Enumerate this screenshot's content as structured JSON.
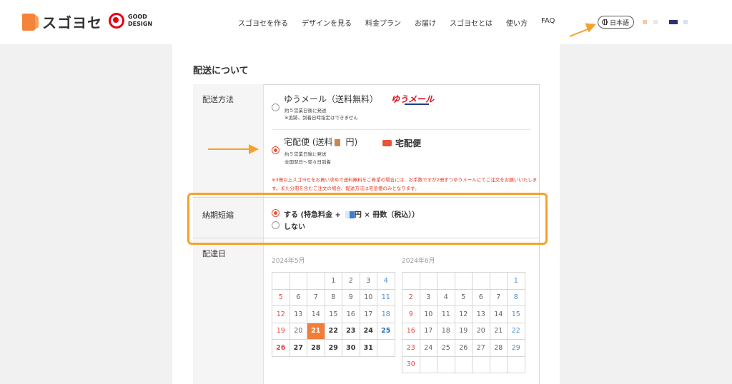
{
  "header": {
    "logo_text": "スゴヨセ",
    "gd_line1": "GOOD",
    "gd_line2": "DESIGN",
    "nav": [
      "スゴヨセを作る",
      "デザインを見る",
      "料金プラン",
      "お届け",
      "スゴヨセとは",
      "使い方",
      "FAQ"
    ],
    "language": "日本語",
    "swatches": [
      "#f9c9a8",
      "#e8e8ec",
      "#2d3270",
      "#d9dff7"
    ]
  },
  "section": {
    "title": "配送について",
    "shipping_label": "配送方法",
    "option_mail": {
      "title": "ゆうメール（送料無料）",
      "note1": "約５営業日後に発送",
      "note2": "※追跡、到着日時指定はできません",
      "logo": "ゆうメール"
    },
    "option_takkyubin": {
      "title_a": "宅配便 (送料",
      "title_b": "円)",
      "note1": "約５営業日後に発送",
      "note2": "全国翌日〜翌々日到着",
      "logo": "宅配便"
    },
    "notice": "※3冊以上スゴヨセをお買い求めで送料無料をご希望の場合には、お手数ですが2冊ずつゆうメールにてご注文をお願いいたします。また分冊を含むご注文の場合、配送方法は宅急便のみとなります。",
    "rush_label": "納期短縮",
    "rush_yes_a": "する (特急料金 +",
    "rush_yes_b": "円 × 冊数（税込））",
    "rush_no": "しない",
    "date_label": "配達日"
  },
  "calendar_may": {
    "title": "2024年5月",
    "rows": [
      [
        "",
        "",
        "",
        "1",
        "2",
        "3",
        "4"
      ],
      [
        "5",
        "6",
        "7",
        "8",
        "9",
        "10",
        "11"
      ],
      [
        "12",
        "13",
        "14",
        "15",
        "16",
        "17",
        "18"
      ],
      [
        "19",
        "20",
        "21",
        "22",
        "23",
        "24",
        "25"
      ],
      [
        "26",
        "27",
        "28",
        "29",
        "30",
        "31",
        ""
      ]
    ],
    "selected": "21"
  },
  "calendar_june": {
    "title": "2024年6月",
    "rows": [
      [
        "",
        "",
        "",
        "",
        "",
        "",
        "1"
      ],
      [
        "2",
        "3",
        "4",
        "5",
        "6",
        "7",
        "8"
      ],
      [
        "9",
        "10",
        "11",
        "12",
        "13",
        "14",
        "15"
      ],
      [
        "16",
        "17",
        "18",
        "19",
        "20",
        "21",
        "22"
      ],
      [
        "23",
        "24",
        "25",
        "26",
        "27",
        "28",
        "29"
      ],
      [
        "30",
        "",
        "",
        "",
        "",
        "",
        ""
      ]
    ]
  },
  "colors": {
    "accent_orange": "#f7a12c",
    "radio_checked": "#e8533a",
    "today_bg": "#f27d3a",
    "notice_red": "#e8341c"
  }
}
